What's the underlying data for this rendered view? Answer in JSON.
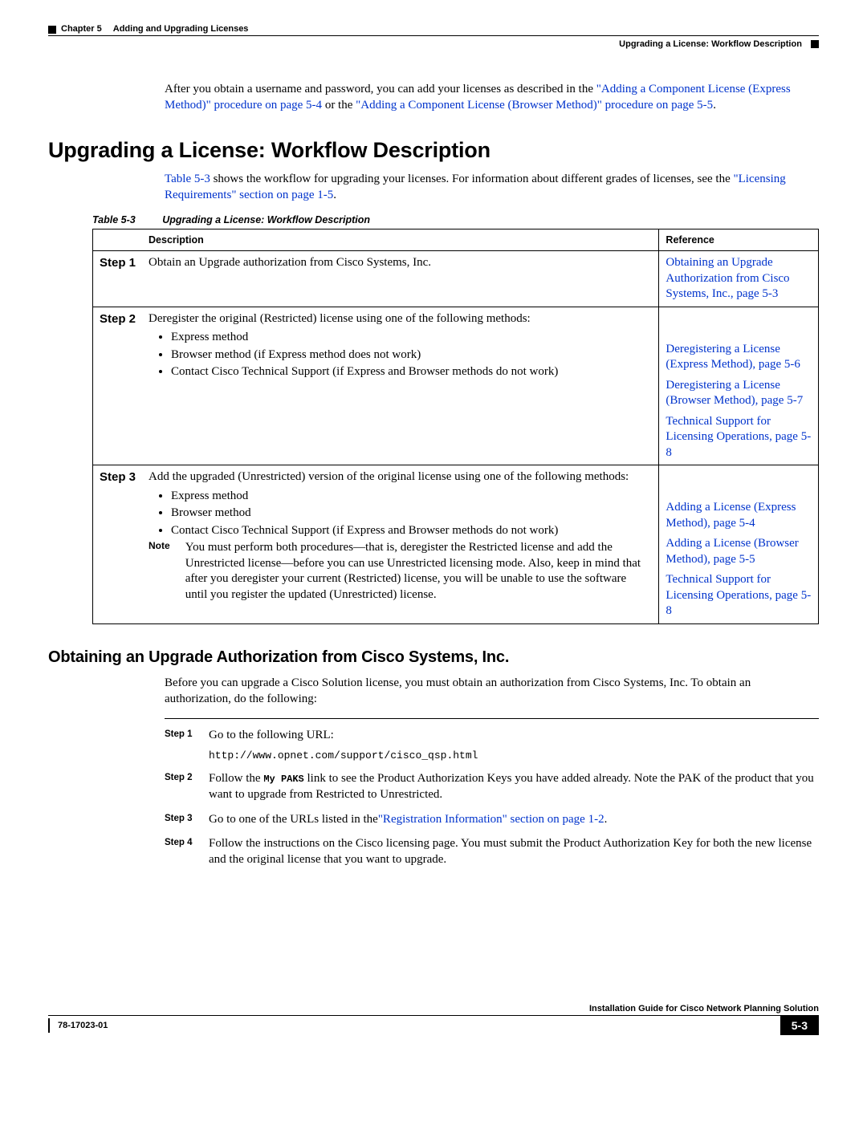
{
  "header": {
    "chapter": "Chapter 5",
    "title": "Adding and Upgrading Licenses",
    "section_path": "Upgrading a License: Workflow Description"
  },
  "intro": {
    "pre": "After you obtain a username and password, you can add your licenses as described in the ",
    "link1": "\"Adding a Component License (Express Method)\" procedure on page 5-4",
    "mid": " or the ",
    "link2": "\"Adding a Component License (Browser Method)\" procedure on page 5-5",
    "post": "."
  },
  "h1": "Upgrading a License: Workflow Description",
  "h1para": {
    "link_tbl": "Table 5-3",
    "mid1": " shows the workflow for upgrading your licenses. For information about different grades of licenses, see the ",
    "link_req": "\"Licensing Requirements\" section on page 1-5",
    "post": "."
  },
  "table": {
    "caption_num": "Table 5-3",
    "caption_txt": "Upgrading a License: Workflow Description",
    "head_desc": "Description",
    "head_ref": "Reference",
    "rows": {
      "s1_label": "Step 1",
      "s1_desc": "Obtain an Upgrade authorization from Cisco Systems, Inc.",
      "s1_ref": "Obtaining an Upgrade Authorization from Cisco Systems, Inc., page 5-3",
      "s2_label": "Step 2",
      "s2_desc": "Deregister the original (Restricted) license using one of the following methods:",
      "s2_b1": "Express method",
      "s2_b2": "Browser method (if Express method does not work)",
      "s2_b3": "Contact Cisco Technical Support (if Express and Browser methods do not work)",
      "s2_r1": "Deregistering a License (Express Method), page 5-6",
      "s2_r2": "Deregistering a License (Browser Method), page 5-7",
      "s2_r3": "Technical Support for Licensing Operations, page 5-8",
      "s3_label": "Step 3",
      "s3_desc": "Add the upgraded (Unrestricted) version of the original license using one of the following methods:",
      "s3_b1": "Express method",
      "s3_b2": "Browser method",
      "s3_b3": "Contact Cisco Technical Support (if Express and Browser methods do not work)",
      "s3_r1": "Adding a License (Express Method), page 5-4",
      "s3_r2": "Adding a License (Browser Method), page 5-5",
      "s3_r3": "Technical Support for Licensing Operations, page 5-8",
      "note_label": "Note",
      "note_body": "You must perform both procedures—that is, deregister the Restricted license and add the Unrestricted license—before you can use Unrestricted licensing mode. Also, keep in mind that after you deregister your current (Restricted) license, you will be unable to use the software until you register the updated (Unrestricted) license."
    }
  },
  "h2": "Obtaining an Upgrade Authorization from Cisco Systems, Inc.",
  "h2para": "Before you can upgrade a Cisco Solution license, you must obtain an authorization from Cisco Systems, Inc. To obtain an authorization, do the following:",
  "steps": {
    "s1l": "Step 1",
    "s1t": "Go to the following URL:",
    "s1u": "http://www.opnet.com/support/cisco_qsp.html",
    "s2l": "Step 2",
    "s2a": "Follow the ",
    "s2b": "My PAKS",
    "s2c": " link to see the Product Authorization Keys you have added already. Note the PAK of the product that you want to upgrade from Restricted to Unrestricted.",
    "s3l": "Step 3",
    "s3a": "Go to one of the URLs listed in the",
    "s3link": "\"Registration Information\" section on page 1-2",
    "s3b": ".",
    "s4l": "Step 4",
    "s4t": "Follow the instructions on the Cisco licensing page. You must submit the Product Authorization Key for both the new license and the original license that you want to upgrade."
  },
  "footer": {
    "doc_title": "Installation Guide for Cisco Network Planning Solution",
    "doc_num": "78-17023-01",
    "page_num": "5-3"
  }
}
